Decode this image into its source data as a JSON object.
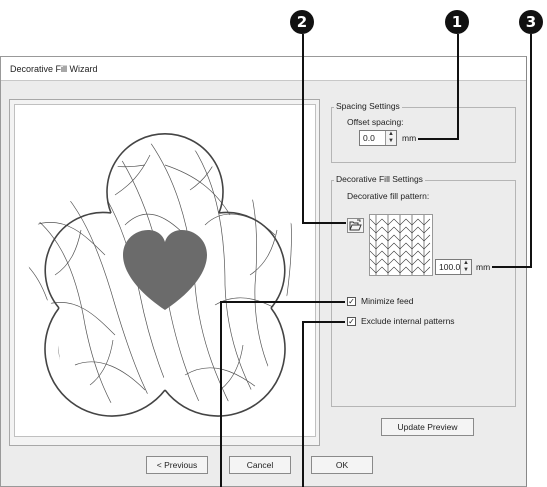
{
  "window": {
    "title": "Decorative Fill Wizard"
  },
  "callouts": {
    "c1": "1",
    "c2": "2",
    "c3": "3"
  },
  "spacing": {
    "group_title": "Spacing Settings",
    "offset_label": "Offset spacing:",
    "offset_value": "0.0",
    "offset_unit": "mm"
  },
  "fill": {
    "group_title": "Decorative Fill Settings",
    "pattern_label": "Decorative fill pattern:",
    "size_value": "100.0",
    "size_unit": "mm"
  },
  "options": {
    "minimize_feed_label": "Minimize feed",
    "minimize_feed_checked": true,
    "exclude_internal_label": "Exclude internal patterns",
    "exclude_internal_checked": true
  },
  "buttons": {
    "update_preview": "Update Preview",
    "previous": "< Previous",
    "cancel": "Cancel",
    "ok": "OK"
  },
  "colors": {
    "heart": "#6b6b6b",
    "outline": "#444444"
  },
  "icons": {
    "pattern_open": "open-folder-icon"
  }
}
